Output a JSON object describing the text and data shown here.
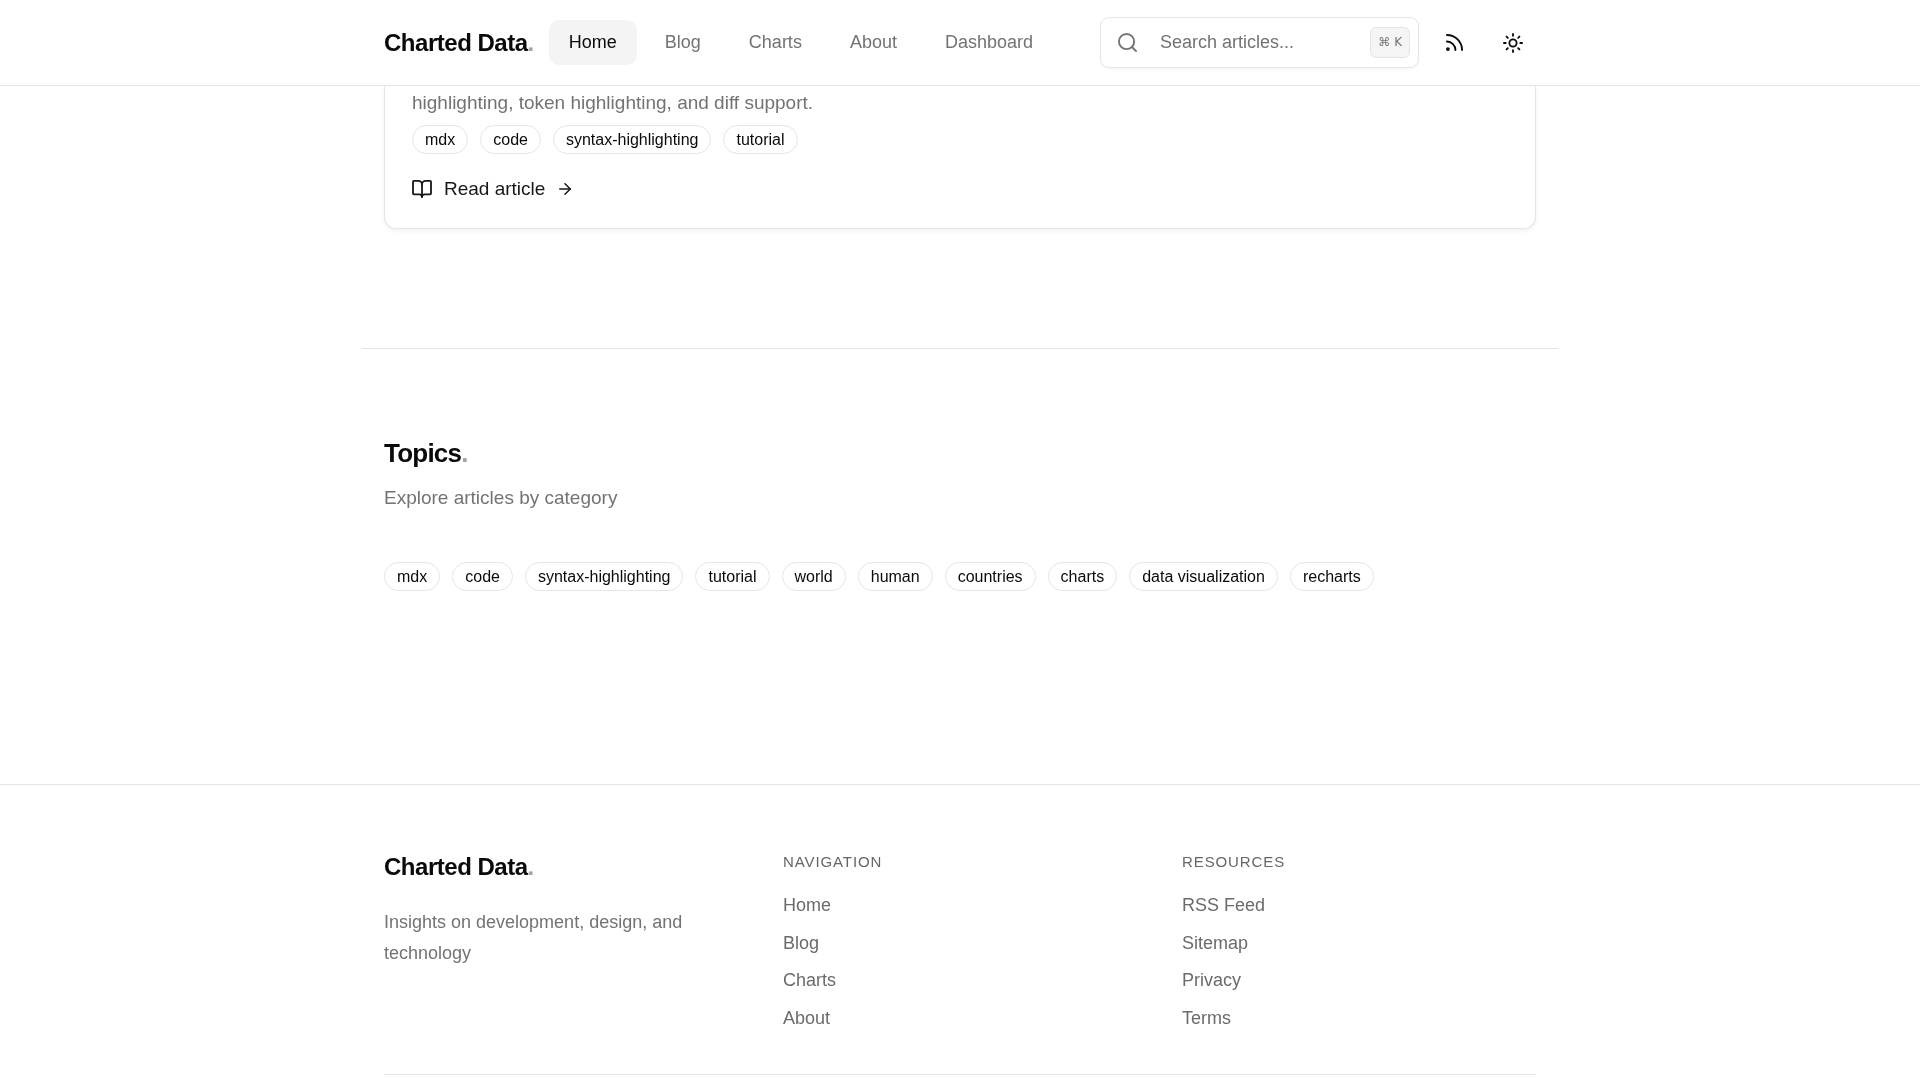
{
  "header": {
    "logo": {
      "text": "Charted Data",
      "accent": "."
    },
    "nav": [
      {
        "label": "Home",
        "selected": true
      },
      {
        "label": "Blog",
        "selected": false
      },
      {
        "label": "Charts",
        "selected": false
      },
      {
        "label": "About",
        "selected": false
      },
      {
        "label": "Dashboard",
        "selected": false
      }
    ],
    "search": {
      "placeholder": "Search articles...",
      "shortcut": "⌘ K"
    }
  },
  "article_card": {
    "excerpt": "highlighting, token highlighting, and diff support.",
    "tags": [
      "mdx",
      "code",
      "syntax-highlighting",
      "tutorial"
    ],
    "link": "Read article"
  },
  "topics": {
    "title": "Topics",
    "accent": ".",
    "subtitle": "Explore articles by category",
    "tags": [
      "mdx",
      "code",
      "syntax-highlighting",
      "tutorial",
      "world",
      "human",
      "countries",
      "charts",
      "data visualization",
      "recharts"
    ]
  },
  "footer": {
    "logo": {
      "text": "Charted Data",
      "accent": "."
    },
    "tagline": "Insights on development, design, and technology",
    "columns": [
      {
        "heading": "NAVIGATION",
        "links": [
          "Home",
          "Blog",
          "Charts",
          "About"
        ]
      },
      {
        "heading": "RESOURCES",
        "links": [
          "RSS Feed",
          "Sitemap",
          "Privacy",
          "Terms"
        ]
      }
    ]
  }
}
